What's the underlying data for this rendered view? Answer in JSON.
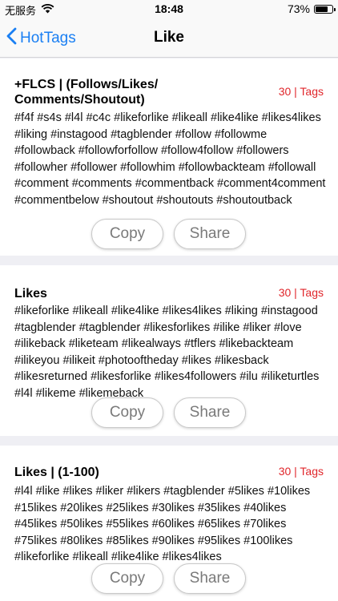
{
  "status_bar": {
    "carrier": "无服务",
    "time": "18:48",
    "battery": "73%",
    "battery_level": 0.73
  },
  "nav": {
    "back_label": "HotTags",
    "title": "Like"
  },
  "cards": [
    {
      "title": "+FLCS | (Follows/Likes/ Comments/Shoutout)",
      "count": "30 | Tags",
      "tags": "#f4f #s4s #l4l #c4c #likeforlike #likeall #like4like #likes4likes #liking #instagood #tagblender #follow #followme #followback #followforfollow #follow4follow #followers #followher #follower #followhim #followbackteam #followall #comment #comments #commentback #comment4comment #commentbelow #shoutout #shoutouts #shoutoutback",
      "copy_label": "Copy",
      "share_label": "Share"
    },
    {
      "title": "Likes",
      "count": "30 | Tags",
      "tags": "#likeforlike #likeall #like4like #likes4likes #liking #instagood #tagblender #tagblender #likesforlikes #ilike #liker #love #ilikeback #liketeam #likealways #tflers #likebackteam #ilikeyou #ilikeit #photooftheday #likes #likesback #likesreturned #likesforlike #likes4followers #ilu #iliketurtles #l4l #likeme #likemeback",
      "copy_label": "Copy",
      "share_label": "Share"
    },
    {
      "title": "Likes | (1-100)",
      "count": "30 | Tags",
      "tags": "#l4l #like #likes #liker #likers #tagblender #5likes #10likes #15likes #20likes #25likes #30likes #35likes #40likes #45likes #50likes #55likes #60likes #65likes #70likes #75likes #80likes #85likes #90likes #95likes #100likes #likeforlike #likeall #like4like #likes4likes",
      "copy_label": "Copy",
      "share_label": "Share"
    }
  ]
}
